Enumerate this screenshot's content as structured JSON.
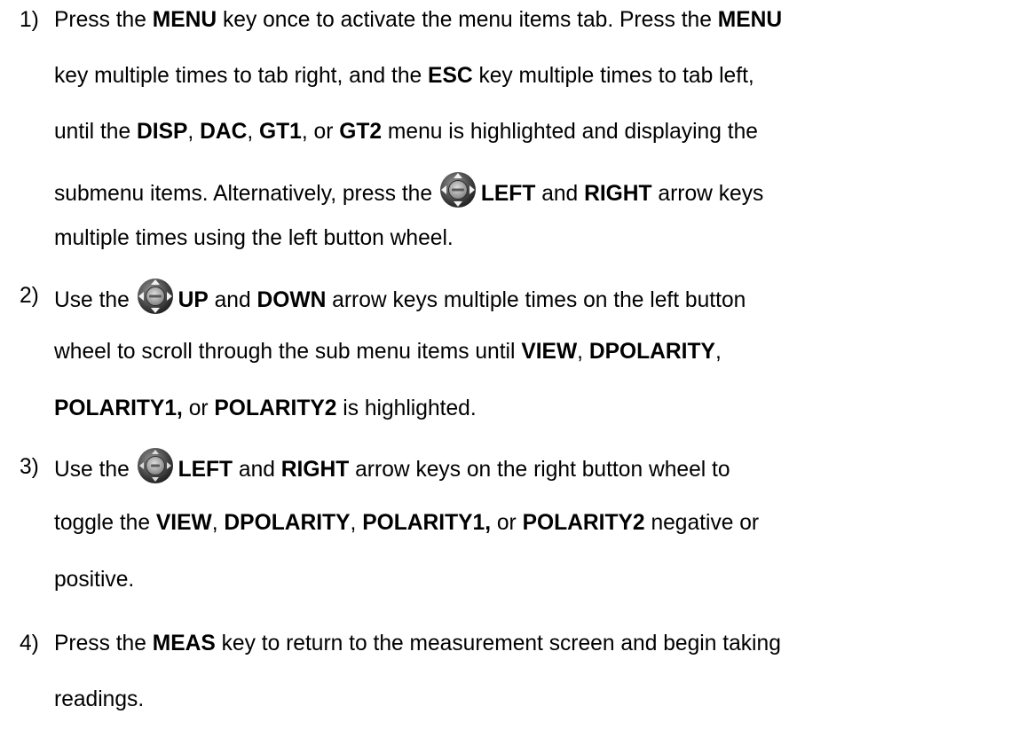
{
  "steps": [
    {
      "number": "1)",
      "lines": [
        [
          {
            "t": "Press the "
          },
          {
            "t": "MENU",
            "b": true
          },
          {
            "t": " key once to activate the menu items tab.  Press the "
          },
          {
            "t": "MENU",
            "b": true
          }
        ],
        [
          {
            "t": "key multiple times to tab right, and the "
          },
          {
            "t": "ESC",
            "b": true
          },
          {
            "t": " key multiple times to tab left,"
          }
        ],
        [
          {
            "t": "until the "
          },
          {
            "t": "DISP",
            "b": true
          },
          {
            "t": ", "
          },
          {
            "t": "DAC",
            "b": true
          },
          {
            "t": ", "
          },
          {
            "t": "GT1",
            "b": true
          },
          {
            "t": ", or "
          },
          {
            "t": "GT2",
            "b": true
          },
          {
            "t": " menu is highlighted and displaying the"
          }
        ],
        [
          {
            "t": "submenu items.  Alternatively, press the "
          },
          {
            "icon": "left-button-wheel-icon"
          },
          {
            "t": "LEFT",
            "b": true
          },
          {
            "t": " and "
          },
          {
            "t": "RIGHT",
            "b": true
          },
          {
            "t": " arrow keys"
          }
        ],
        [
          {
            "t": "multiple times using the left button wheel."
          }
        ]
      ]
    },
    {
      "number": "2)",
      "lines": [
        [
          {
            "t": "Use the "
          },
          {
            "icon": "left-button-wheel-icon"
          },
          {
            "t": "UP",
            "b": true
          },
          {
            "t": " and "
          },
          {
            "t": "DOWN",
            "b": true
          },
          {
            "t": " arrow keys multiple times on the left button"
          }
        ],
        [
          {
            "t": "wheel to scroll through the sub menu items until "
          },
          {
            "t": "VIEW",
            "b": true
          },
          {
            "t": ", "
          },
          {
            "t": "DPOLARITY",
            "b": true
          },
          {
            "t": ","
          }
        ],
        [
          {
            "t": "POLARITY1,",
            "b": true
          },
          {
            "t": " or "
          },
          {
            "t": "POLARITY2",
            "b": true
          },
          {
            "t": " is highlighted."
          }
        ]
      ]
    },
    {
      "number": "3)",
      "lines": [
        [
          {
            "t": "Use the "
          },
          {
            "icon": "right-button-wheel-icon"
          },
          {
            "t": "LEFT",
            "b": true
          },
          {
            "t": " and "
          },
          {
            "t": "RIGHT",
            "b": true
          },
          {
            "t": " arrow keys on the right button wheel to"
          }
        ],
        [
          {
            "t": "toggle the "
          },
          {
            "t": "VIEW",
            "b": true
          },
          {
            "t": ", "
          },
          {
            "t": "DPOLARITY",
            "b": true
          },
          {
            "t": ", "
          },
          {
            "t": "POLARITY1,",
            "b": true
          },
          {
            "t": " or "
          },
          {
            "t": "POLARITY2",
            "b": true
          },
          {
            "t": " negative or"
          }
        ],
        [
          {
            "t": "positive."
          }
        ]
      ]
    },
    {
      "number": "4)",
      "lines": [
        [
          {
            "t": "Press the "
          },
          {
            "t": "MEAS",
            "b": true
          },
          {
            "t": " key to return to the measurement screen and begin taking"
          }
        ],
        [
          {
            "t": "readings."
          }
        ]
      ]
    }
  ]
}
